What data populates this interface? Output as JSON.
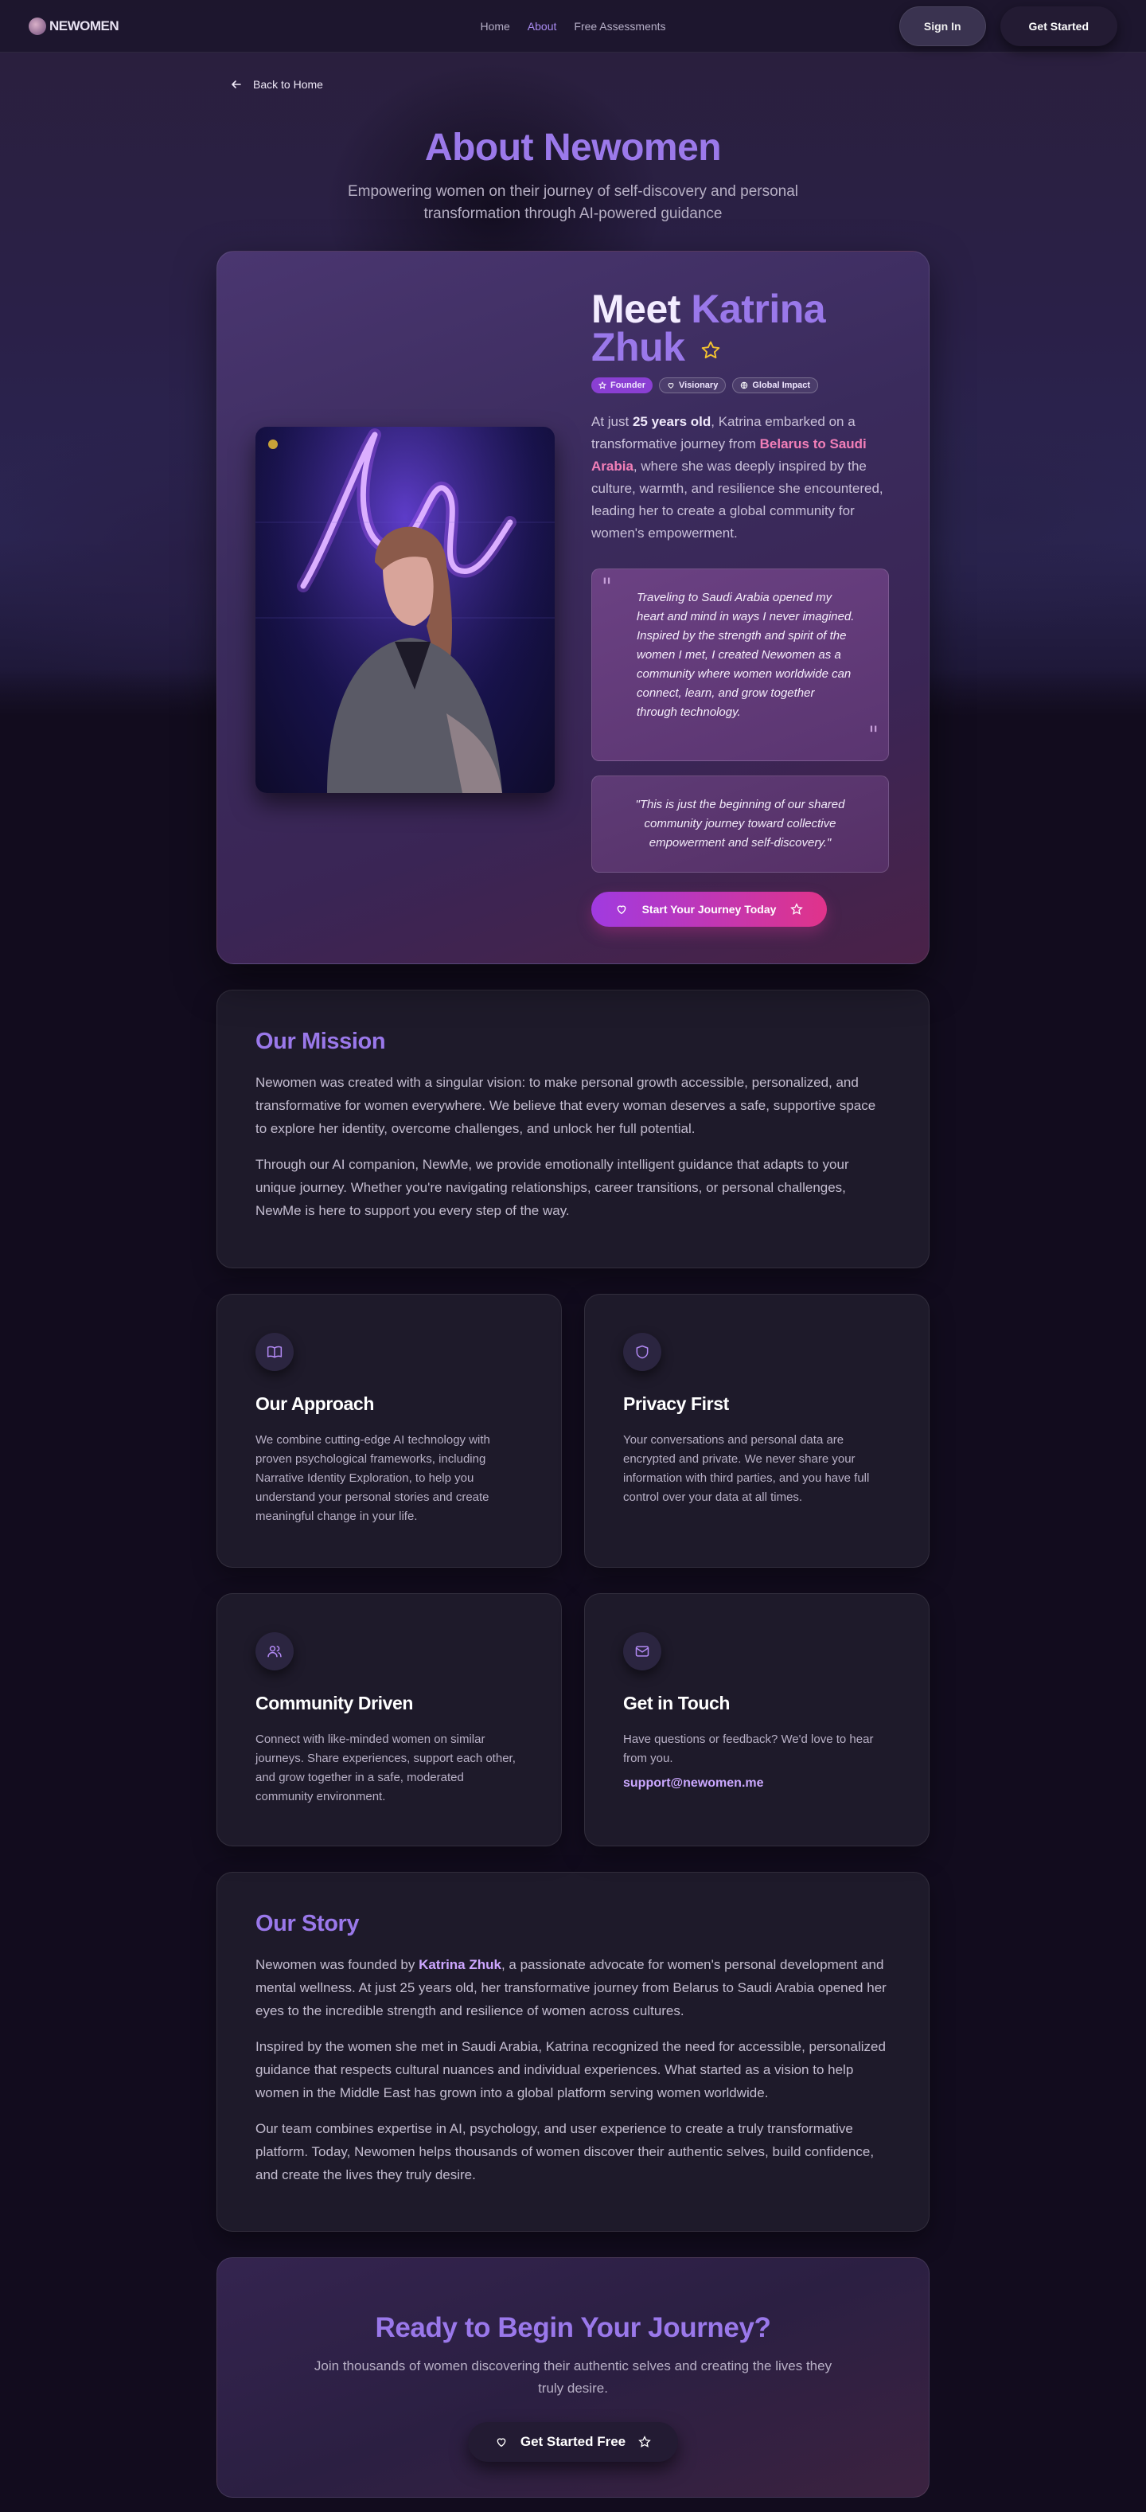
{
  "nav": {
    "logo": "NEWOMEN",
    "links": [
      {
        "label": "Home"
      },
      {
        "label": "About"
      },
      {
        "label": "Free Assessments"
      }
    ],
    "sign_in": "Sign In",
    "get_started": "Get Started"
  },
  "back_link": "Back to Home",
  "header": {
    "title": "About Newomen",
    "subtitle": "Empowering women on their journey of self-discovery and personal transformation through AI-powered guidance"
  },
  "hero": {
    "meet_word": "Meet",
    "first_name": "Katrina",
    "last_name": "Zhuk",
    "badges": [
      "Founder",
      "Visionary",
      "Global Impact"
    ],
    "intro_prefix": "At just ",
    "intro_age": "25 years old",
    "intro_mid": ", Katrina embarked on a transformative journey from ",
    "intro_route": "Belarus to Saudi Arabia",
    "intro_suffix": ", where she was deeply inspired by the culture, warmth, and resilience she encountered, leading her to create a global community for women's empowerment.",
    "quote": "Traveling to Saudi Arabia opened my heart and mind in ways I never imagined. Inspired by the strength and spirit of the women I met, I created Newomen as a community where women worldwide can connect, learn, and grow together through technology.",
    "quote2": "\"This is just the beginning of our shared community journey toward collective empowerment and self-discovery.\"",
    "cta": "Start Your Journey Today"
  },
  "mission": {
    "title": "Our Mission",
    "p1": "Newomen was created with a singular vision: to make personal growth accessible, personalized, and transformative for women everywhere. We believe that every woman deserves a safe, supportive space to explore her identity, overcome challenges, and unlock her full potential.",
    "p2": "Through our AI companion, NewMe, we provide emotionally intelligent guidance that adapts to your unique journey. Whether you're navigating relationships, career transitions, or personal challenges, NewMe is here to support you every step of the way."
  },
  "features": [
    {
      "icon": "book-open-icon",
      "title": "Our Approach",
      "text": "We combine cutting-edge AI technology with proven psychological frameworks, including Narrative Identity Exploration, to help you understand your personal stories and create meaningful change in your life."
    },
    {
      "icon": "shield-icon",
      "title": "Privacy First",
      "text": "Your conversations and personal data are encrypted and private. We never share your information with third parties, and you have full control over your data at all times."
    },
    {
      "icon": "users-icon",
      "title": "Community Driven",
      "text": "Connect with like-minded women on similar journeys. Share experiences, support each other, and grow together in a safe, moderated community environment."
    },
    {
      "icon": "mail-icon",
      "title": "Get in Touch",
      "text": "Have questions or feedback? We'd love to hear from you.",
      "email": "support@newomen.me"
    }
  ],
  "story": {
    "title": "Our Story",
    "p1_prefix": "Newomen was founded by ",
    "p1_name": "Katrina Zhuk",
    "p1_suffix": ", a passionate advocate for women's personal development and mental wellness. At just 25 years old, her transformative journey from Belarus to Saudi Arabia opened her eyes to the incredible strength and resilience of women across cultures.",
    "p2": "Inspired by the women she met in Saudi Arabia, Katrina recognized the need for accessible, personalized guidance that respects cultural nuances and individual experiences. What started as a vision to help women in the Middle East has grown into a global platform serving women worldwide.",
    "p3": "Our team combines expertise in AI, psychology, and user experience to create a truly transformative platform. Today, Newomen helps thousands of women discover their authentic selves, build confidence, and create the lives they truly desire."
  },
  "cta": {
    "title": "Ready to Begin Your Journey?",
    "subtitle": "Join thousands of women discovering their authentic selves and creating the lives they truly desire.",
    "button": "Get Started Free"
  },
  "colors": {
    "accent": "#9a78ea",
    "pink": "#f27fb8",
    "background": "#120c1e",
    "card": "#1e1a2a"
  }
}
